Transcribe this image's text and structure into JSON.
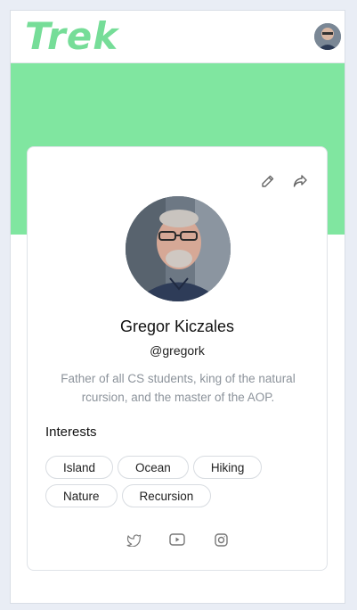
{
  "app": {
    "brand": "Trek"
  },
  "header": {
    "avatar_icon": "user-avatar-photo"
  },
  "theme": {
    "accent": "#80e6a0",
    "brand_text": "#76dd98"
  },
  "profile": {
    "name": "Gregor Kiczales",
    "handle": "@gregork",
    "bio": "Father of all CS students, king of the natural rcursion, and the master of the AOP.",
    "actions": [
      {
        "icon": "pencil-icon"
      },
      {
        "icon": "share-icon"
      }
    ]
  },
  "interests": {
    "title": "Interests",
    "items": [
      "Island",
      "Ocean",
      "Hiking",
      "Nature",
      "Recursion"
    ]
  },
  "socials": [
    {
      "icon": "twitter-icon"
    },
    {
      "icon": "youtube-icon"
    },
    {
      "icon": "instagram-icon"
    }
  ]
}
